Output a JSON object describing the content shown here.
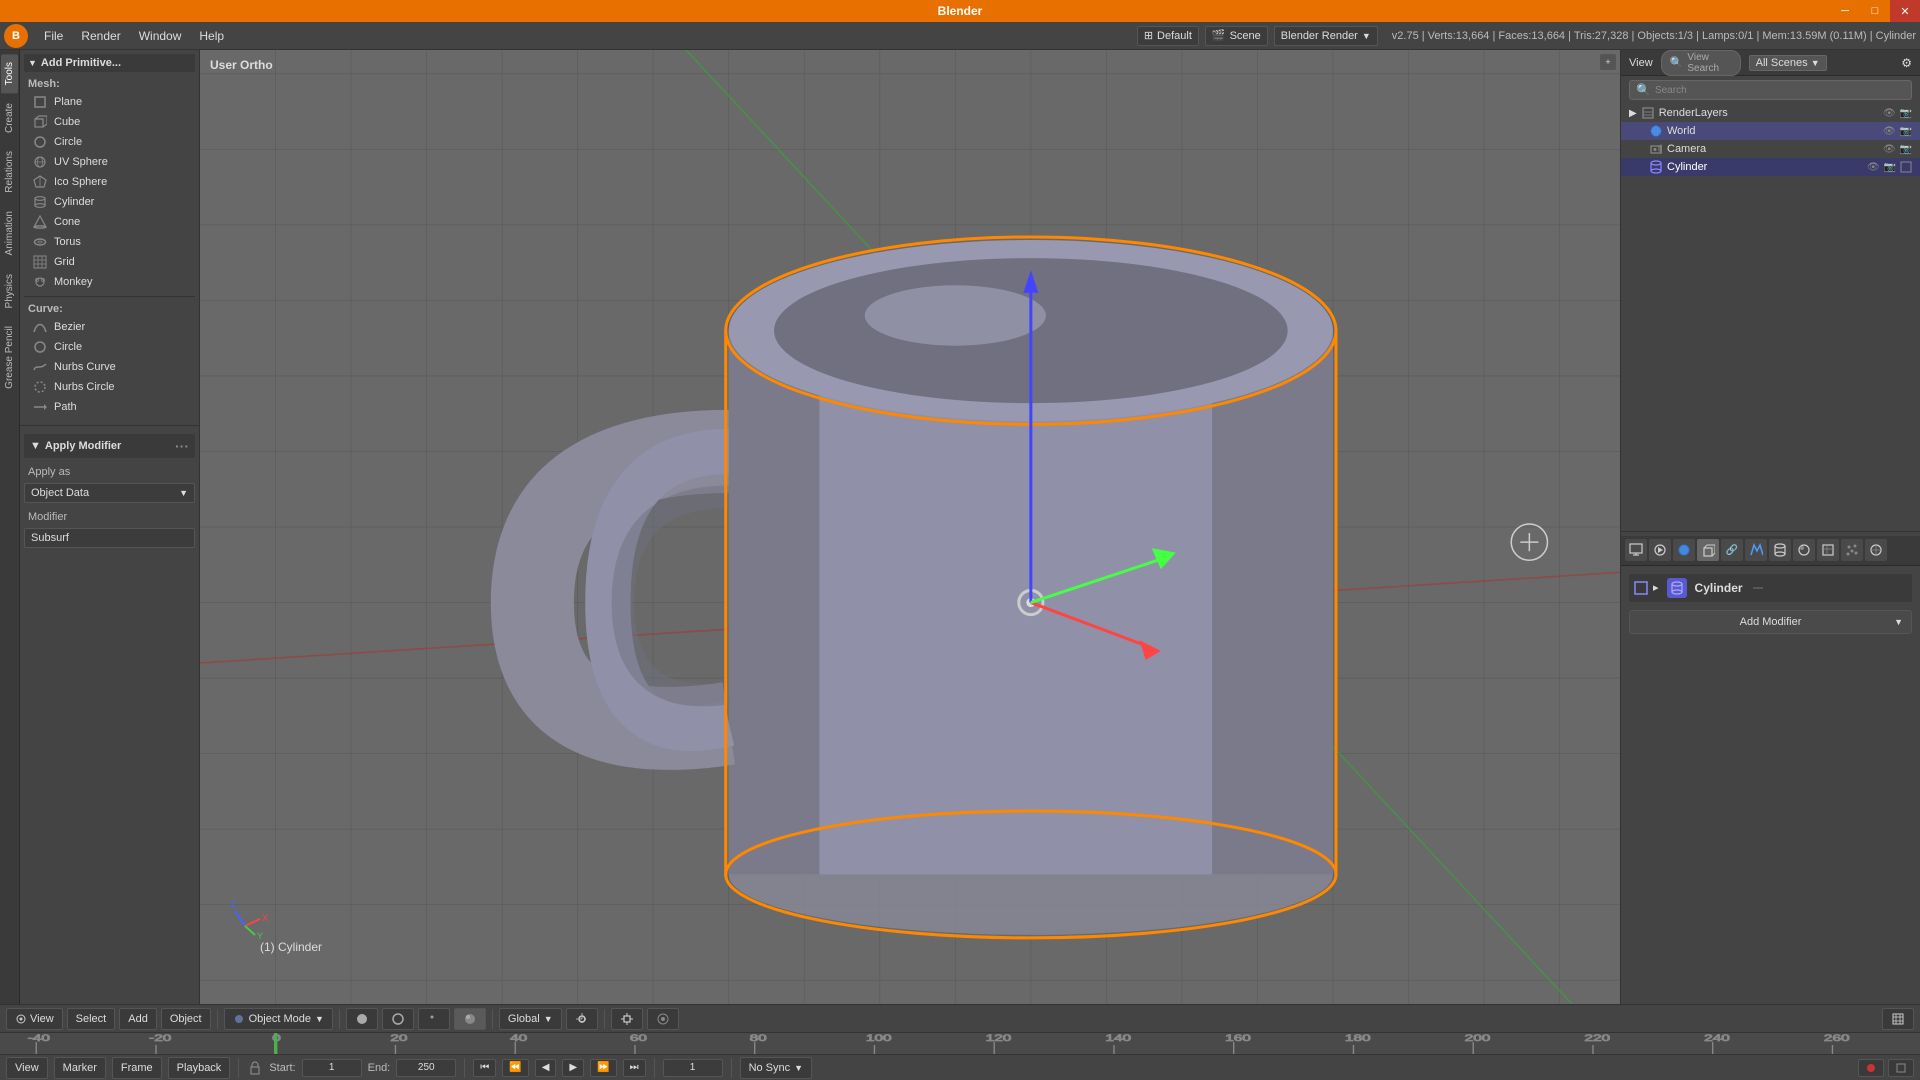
{
  "titlebar": {
    "title": "Blender",
    "minimize": "─",
    "maximize": "□",
    "close": "✕"
  },
  "menubar": {
    "logo": "B",
    "items": [
      "File",
      "Render",
      "Window",
      "Help"
    ]
  },
  "infobar": {
    "view_label": "Default",
    "scene_label": "Scene",
    "render_engine": "Blender Render",
    "stats": "v2.75 | Verts:13,664 | Faces:13,664 | Tris:27,328 | Objects:1/3 | Lamps:0/1 | Mem:13.59M (0.11M) | Cylinder"
  },
  "left_panel": {
    "add_primitive_title": "Add Primitive...",
    "mesh_label": "Mesh:",
    "mesh_items": [
      {
        "label": "Plane",
        "icon": "□"
      },
      {
        "label": "Cube",
        "icon": "▣"
      },
      {
        "label": "Circle",
        "icon": "○"
      },
      {
        "label": "UV Sphere",
        "icon": "◎"
      },
      {
        "label": "Ico Sphere",
        "icon": "◈"
      },
      {
        "label": "Cylinder",
        "icon": "⬡"
      },
      {
        "label": "Cone",
        "icon": "△"
      },
      {
        "label": "Torus",
        "icon": "◉"
      },
      {
        "label": "Grid",
        "icon": "⊞"
      },
      {
        "label": "Monkey",
        "icon": "♦"
      }
    ],
    "curve_label": "Curve:",
    "curve_items": [
      {
        "label": "Bezier",
        "icon": "~"
      },
      {
        "label": "Circle",
        "icon": "○"
      },
      {
        "label": "Nurbs Curve",
        "icon": "~"
      },
      {
        "label": "Nurbs Circle",
        "icon": "○"
      },
      {
        "label": "Path",
        "icon": "→"
      }
    ],
    "apply_modifier_title": "Apply Modifier",
    "apply_as_label": "Apply as",
    "apply_as_value": "Object Data",
    "modifier_label": "Modifier",
    "modifier_value": "Subsurf"
  },
  "viewport": {
    "label": "User Ortho",
    "object_name": "(1) Cylinder"
  },
  "right_panel": {
    "outliner_title": "View",
    "outliner_search_placeholder": "View Search",
    "all_scenes": "All Scenes",
    "items": [
      {
        "label": "RenderLayers",
        "icon": "📷",
        "indent": 0
      },
      {
        "label": "World",
        "icon": "🌐",
        "indent": 1,
        "selected": true
      },
      {
        "label": "Camera",
        "icon": "📷",
        "indent": 1
      },
      {
        "label": "Cylinder",
        "icon": "⬡",
        "indent": 1,
        "active": true
      }
    ],
    "properties_tabs": [
      "scene",
      "world",
      "object",
      "mesh",
      "material",
      "texture",
      "particle",
      "physics",
      "constraints",
      "modifier",
      "data"
    ],
    "object_name": "Cylinder",
    "add_modifier_label": "Add Modifier"
  },
  "bottom_toolbar": {
    "view_label": "View",
    "select_label": "Select",
    "add_label": "Add",
    "object_label": "Object",
    "mode_label": "Object Mode",
    "global_label": "Global",
    "pivot_label": "Individual Origins"
  },
  "timeline": {
    "start_label": "Start:",
    "start_value": "1",
    "end_label": "End:",
    "end_value": "250",
    "current_frame": "1",
    "sync_label": "No Sync",
    "ruler_marks": [
      "-40",
      "-20",
      "0",
      "20",
      "40",
      "60",
      "80",
      "100",
      "120",
      "140",
      "160",
      "180",
      "200",
      "220",
      "240",
      "260"
    ]
  },
  "side_tabs": [
    "Tools",
    "Create",
    "Relations",
    "Animation",
    "Physics",
    "Grease Pencil"
  ]
}
